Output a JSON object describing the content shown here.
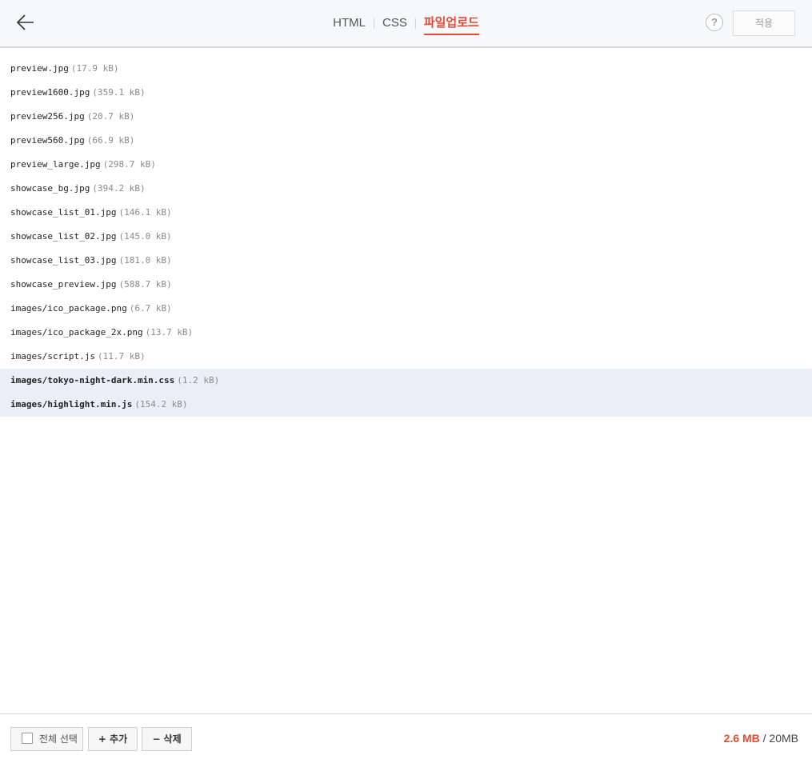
{
  "header": {
    "tabs": [
      {
        "label": "HTML",
        "active": false
      },
      {
        "label": "CSS",
        "active": false
      },
      {
        "label": "파일업로드",
        "active": true
      }
    ],
    "help_label": "?",
    "apply_label": "적용"
  },
  "files": [
    {
      "name": "preview.jpg",
      "size": "(17.9 kB)",
      "selected": false
    },
    {
      "name": "preview1600.jpg",
      "size": "(359.1 kB)",
      "selected": false
    },
    {
      "name": "preview256.jpg",
      "size": "(20.7 kB)",
      "selected": false
    },
    {
      "name": "preview560.jpg",
      "size": "(66.9 kB)",
      "selected": false
    },
    {
      "name": "preview_large.jpg",
      "size": "(298.7 kB)",
      "selected": false
    },
    {
      "name": "showcase_bg.jpg",
      "size": "(394.2 kB)",
      "selected": false
    },
    {
      "name": "showcase_list_01.jpg",
      "size": "(146.1 kB)",
      "selected": false
    },
    {
      "name": "showcase_list_02.jpg",
      "size": "(145.0 kB)",
      "selected": false
    },
    {
      "name": "showcase_list_03.jpg",
      "size": "(181.0 kB)",
      "selected": false
    },
    {
      "name": "showcase_preview.jpg",
      "size": "(588.7 kB)",
      "selected": false
    },
    {
      "name": "images/ico_package.png",
      "size": "(6.7 kB)",
      "selected": false
    },
    {
      "name": "images/ico_package_2x.png",
      "size": "(13.7 kB)",
      "selected": false
    },
    {
      "name": "images/script.js",
      "size": "(11.7 kB)",
      "selected": false
    },
    {
      "name": "images/tokyo-night-dark.min.css",
      "size": "(1.2 kB)",
      "selected": true
    },
    {
      "name": "images/highlight.min.js",
      "size": "(154.2 kB)",
      "selected": true
    }
  ],
  "footer": {
    "select_all_label": "전체 선택",
    "add_label": "+ 추가",
    "delete_label": "− 삭제",
    "used": "2.6 MB",
    "separator": " / ",
    "limit": "20MB"
  },
  "colors": {
    "accent": "#e54b32",
    "selected_row_bg": "#eaeef7",
    "header_bg": "#f7f8fa"
  }
}
